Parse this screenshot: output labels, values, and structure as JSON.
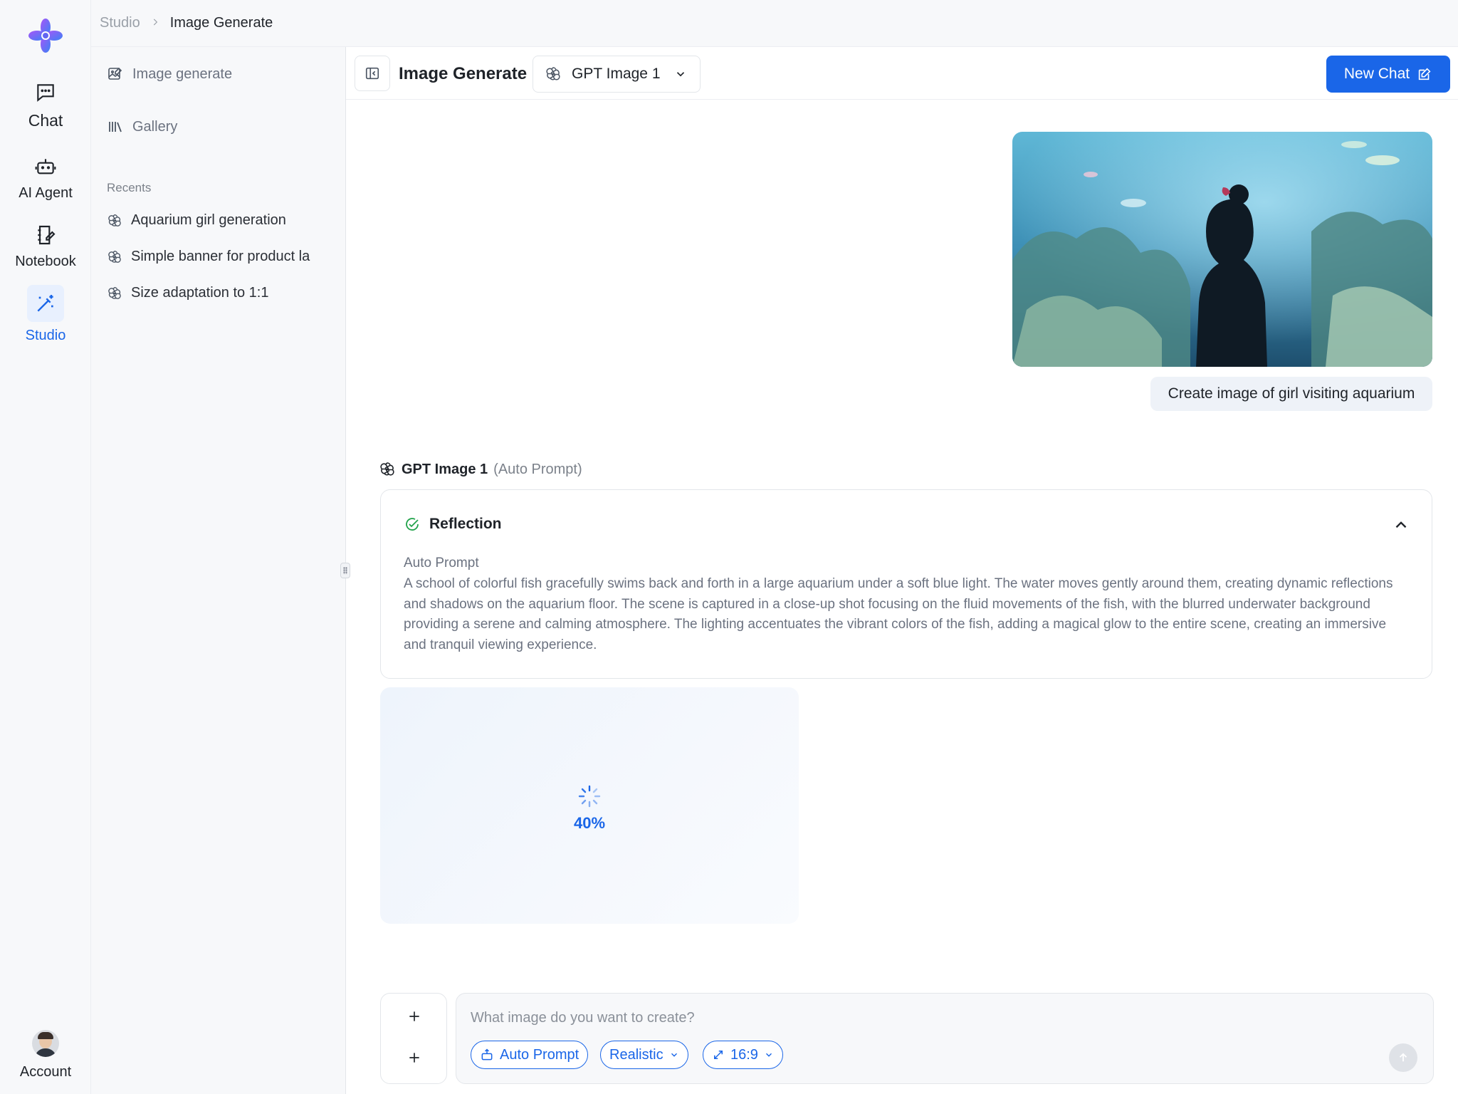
{
  "rail": {
    "items": [
      {
        "label": "Chat",
        "icon": "chat-icon"
      },
      {
        "label": "AI Agent",
        "icon": "robot-icon"
      },
      {
        "label": "Notebook",
        "icon": "notebook-icon"
      },
      {
        "label": "Studio",
        "icon": "magic-wand-icon",
        "active": true
      }
    ],
    "account_label": "Account"
  },
  "breadcrumb": {
    "parent": "Studio",
    "current": "Image Generate"
  },
  "sidebar": {
    "links": [
      {
        "label": "Image generate",
        "icon": "image-edit-icon"
      },
      {
        "label": "Gallery",
        "icon": "library-icon"
      }
    ],
    "recents_label": "Recents",
    "recents": [
      {
        "label": "Aquarium girl generation"
      },
      {
        "label": "Simple banner for product la"
      },
      {
        "label": "Size adaptation to 1:1"
      }
    ]
  },
  "header": {
    "title": "Image Generate",
    "model": "GPT Image 1",
    "new_chat_label": "New Chat"
  },
  "conversation": {
    "user_message": "Create image of girl visiting aquarium",
    "bot_name": "GPT Image 1",
    "bot_mode": "(Auto Prompt)",
    "reflection_title": "Reflection",
    "auto_prompt_label": "Auto Prompt",
    "auto_prompt_text": "A school of colorful fish gracefully swims back and forth in a large aquarium under a soft blue light. The water moves gently around them, creating dynamic reflections and shadows on the aquarium floor. The scene is captured in a close-up shot focusing on the fluid movements of the fish, with the blurred underwater background providing a serene and calming atmosphere. The lighting accentuates the vibrant colors of the fish, adding a magical glow to the entire scene, creating an immersive and tranquil viewing experience.",
    "progress_percent": "40%"
  },
  "composer": {
    "placeholder": "What image do you want to create?",
    "chips": {
      "auto_prompt": "Auto Prompt",
      "style": "Realistic",
      "ratio": "16:9"
    }
  },
  "colors": {
    "accent": "#1a66e8",
    "rail_bg": "#f7f8fa",
    "success": "#22a34b"
  }
}
